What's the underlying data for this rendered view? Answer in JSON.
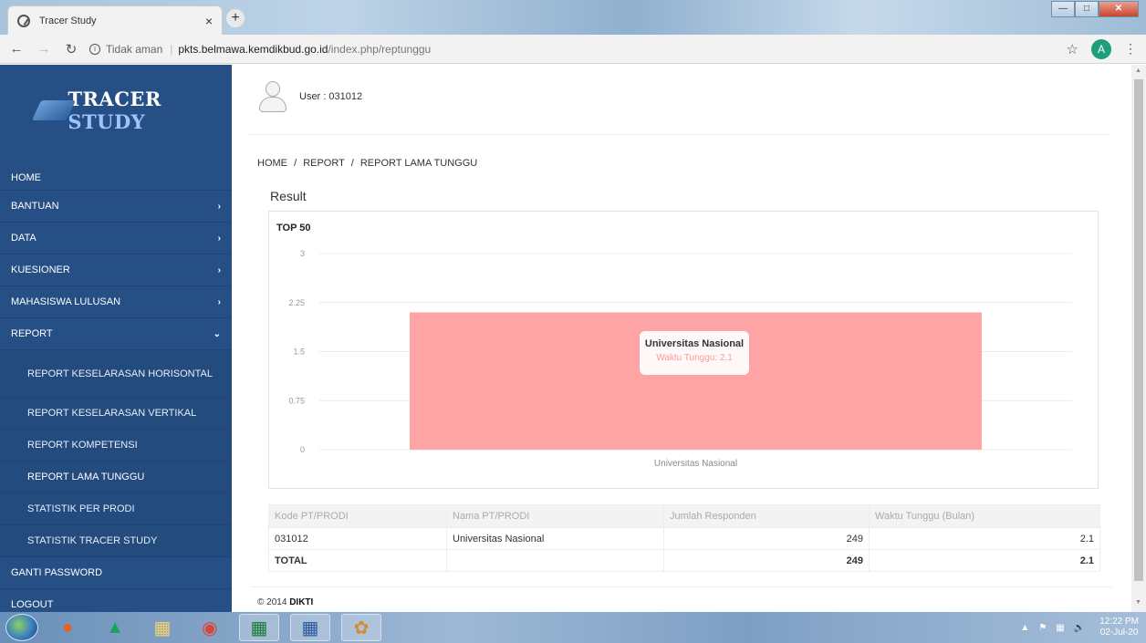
{
  "browser": {
    "tab_title": "Tracer Study",
    "tab_close": "×",
    "new_tab": "+",
    "url_insecure": "Tidak aman",
    "url_domain": "pkts.belmawa.kemdikbud.go.id",
    "url_path": "/index.php/reptunggu",
    "profile_initial": "A"
  },
  "sidebar": {
    "logo_text_1": "TRACER",
    "logo_text_2": "STUDY",
    "items": [
      {
        "label": "HOME"
      },
      {
        "label": "BANTUAN",
        "chevron": "›"
      },
      {
        "label": "DATA",
        "chevron": "›"
      },
      {
        "label": "KUESIONER",
        "chevron": "›"
      },
      {
        "label": "MAHASISWA LULUSAN",
        "chevron": "›"
      },
      {
        "label": "REPORT",
        "chevron": "⌄"
      },
      {
        "label": "GANTI PASSWORD"
      },
      {
        "label": "LOGOUT"
      }
    ],
    "report_subitems": [
      {
        "label": "REPORT KESELARASAN HORISONTAL"
      },
      {
        "label": "REPORT KESELARASAN VERTIKAL"
      },
      {
        "label": "REPORT KOMPETENSI"
      },
      {
        "label": "REPORT LAMA TUNGGU"
      },
      {
        "label": "STATISTIK PER PRODI"
      },
      {
        "label": "STATISTIK TRACER STUDY"
      }
    ]
  },
  "user": {
    "label": "User : 031012"
  },
  "breadcrumb": {
    "home": "HOME",
    "sep": "/",
    "report": "REPORT",
    "current": "REPORT LAMA TUNGGU"
  },
  "result_title": "Result",
  "chart_heading": "TOP 50",
  "chart_data": {
    "type": "bar",
    "title": "TOP 50",
    "categories": [
      "Universitas Nasional"
    ],
    "values": [
      2.1
    ],
    "ylim": [
      0,
      3
    ],
    "yticks": [
      "0",
      "0.75",
      "1.5",
      "2.25",
      "3"
    ],
    "bar_color": "#ffa4a4",
    "grid": true,
    "tooltip": {
      "name": "Universitas Nasional",
      "value_label": "Waktu Tunggu: 2.1"
    }
  },
  "table": {
    "headers": [
      "Kode PT/PRODI",
      "Nama PT/PRODI",
      "Jumlah Responden",
      "Waktu Tunggu (Bulan)"
    ],
    "rows": [
      [
        "031012",
        "Universitas Nasional",
        "249",
        "2.1"
      ]
    ],
    "total": {
      "label": "TOTAL",
      "responden": "249",
      "waktu": "2.1"
    }
  },
  "footer": {
    "copyright": "© 2014",
    "org": "DIKTI"
  },
  "taskbar": {
    "clock_time": "12:22 PM",
    "clock_date": "02-Jul-20"
  }
}
